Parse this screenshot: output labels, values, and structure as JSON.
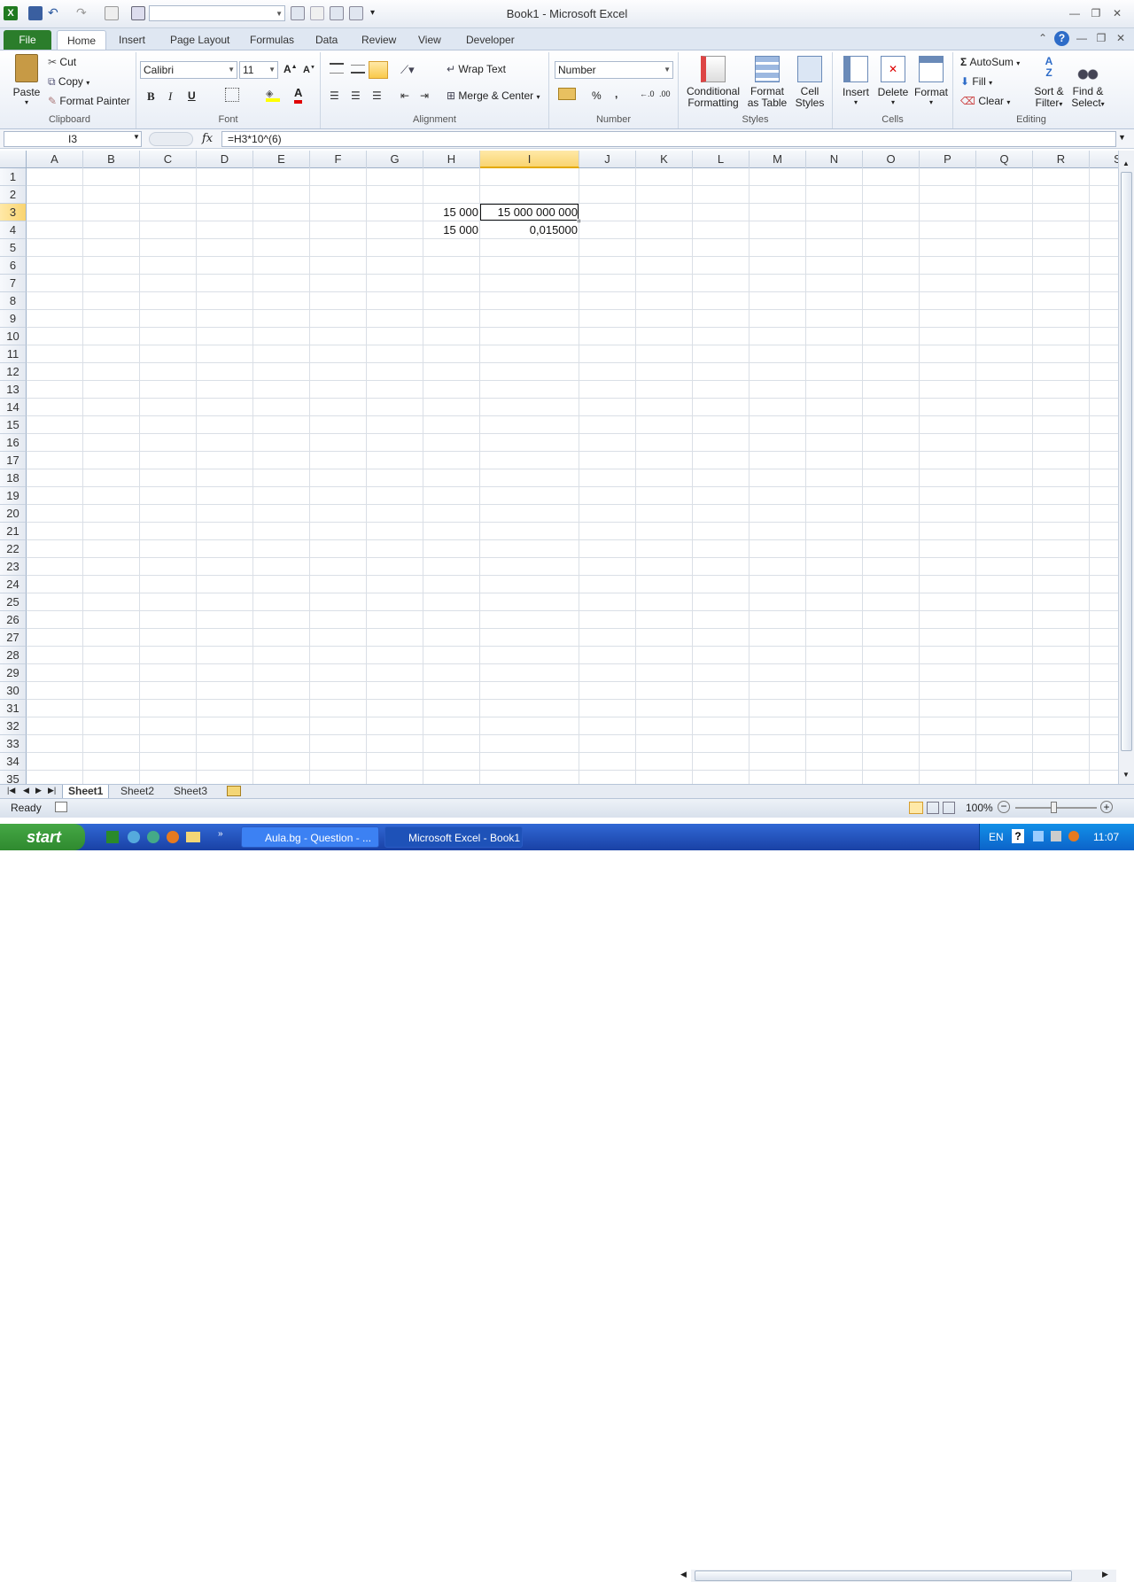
{
  "window": {
    "title": "Book1  -  Microsoft Excel"
  },
  "tabs": [
    {
      "label": "File"
    },
    {
      "label": "Home"
    },
    {
      "label": "Insert"
    },
    {
      "label": "Page Layout"
    },
    {
      "label": "Formulas"
    },
    {
      "label": "Data"
    },
    {
      "label": "Review"
    },
    {
      "label": "View"
    },
    {
      "label": "Developer"
    }
  ],
  "ribbon": {
    "clipboard": {
      "label": "Clipboard",
      "paste": "Paste",
      "cut": "Cut",
      "copy": "Copy",
      "format_painter": "Format Painter"
    },
    "font": {
      "label": "Font",
      "font_name": "Calibri",
      "font_size": "11",
      "bold": "B",
      "italic": "I",
      "underline": "U"
    },
    "alignment": {
      "label": "Alignment",
      "wrap_text": "Wrap Text",
      "merge_center": "Merge & Center"
    },
    "number": {
      "label": "Number",
      "format": "Number",
      "percent": "%",
      "comma": ","
    },
    "styles": {
      "label": "Styles",
      "conditional": "Conditional",
      "conditional2": "Formatting",
      "format_table": "Format",
      "format_table2": "as Table",
      "cell_styles": "Cell",
      "cell_styles2": "Styles"
    },
    "cells": {
      "label": "Cells",
      "insert": "Insert",
      "delete": "Delete",
      "format": "Format"
    },
    "editing": {
      "label": "Editing",
      "autosum": "AutoSum",
      "fill": "Fill",
      "clear": "Clear",
      "sort": "Sort &",
      "sort2": "Filter",
      "find": "Find &",
      "find2": "Select"
    }
  },
  "formula_bar": {
    "name_box": "I3",
    "fx": "fx",
    "formula": "=H3*10^(6)"
  },
  "columns": [
    "A",
    "B",
    "C",
    "D",
    "E",
    "F",
    "G",
    "H",
    "I",
    "J",
    "K",
    "L",
    "M",
    "N",
    "O",
    "P",
    "Q",
    "R",
    "S"
  ],
  "rows": [
    "1",
    "2",
    "3",
    "4",
    "5",
    "6",
    "7",
    "8",
    "9",
    "10",
    "11",
    "12",
    "13",
    "14",
    "15",
    "16",
    "17",
    "18",
    "19",
    "20",
    "21",
    "22",
    "23",
    "24",
    "25",
    "26",
    "27",
    "28",
    "29",
    "30",
    "31",
    "32",
    "33",
    "34",
    "35"
  ],
  "cells": {
    "H3": "15 000",
    "I3": "15 000 000 000",
    "H4": "15 000",
    "I4": "0,015000"
  },
  "selected_cell": "I3",
  "sheets": [
    {
      "name": "Sheet1"
    },
    {
      "name": "Sheet2"
    },
    {
      "name": "Sheet3"
    }
  ],
  "status": {
    "ready": "Ready",
    "zoom": "100%"
  },
  "taskbar": {
    "start": "start",
    "task1": "Aula.bg - Question - ...",
    "task2": "Microsoft Excel - Book1",
    "lang": "EN",
    "time": "11:07"
  }
}
